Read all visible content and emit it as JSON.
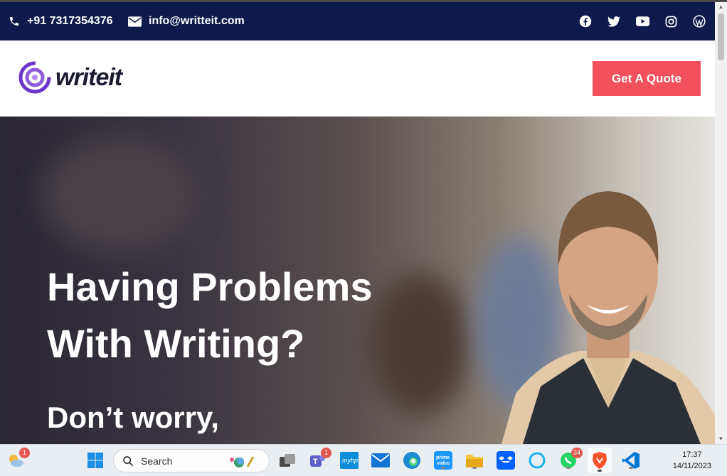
{
  "topbar": {
    "phone": "+91 7317354376",
    "email": "info@writteit.com",
    "socials": [
      "facebook-icon",
      "twitter-icon",
      "youtube-icon",
      "instagram-icon",
      "wordpress-icon"
    ]
  },
  "header": {
    "logo_text": "writeit",
    "cta_label": "Get A Quote"
  },
  "hero": {
    "headline": "Having Problems With Writing?",
    "subheadline": "Don’t worry,"
  },
  "taskbar": {
    "search_placeholder": "Search",
    "weather_badge": "1",
    "teams_badge": "1",
    "whatsapp_badge": "34",
    "time": "17:37",
    "date": "14/11/2023"
  },
  "colors": {
    "topbar_bg": "#0d1a4a",
    "cta_bg": "#f1505c",
    "logo_purple": "#6a36c9"
  }
}
